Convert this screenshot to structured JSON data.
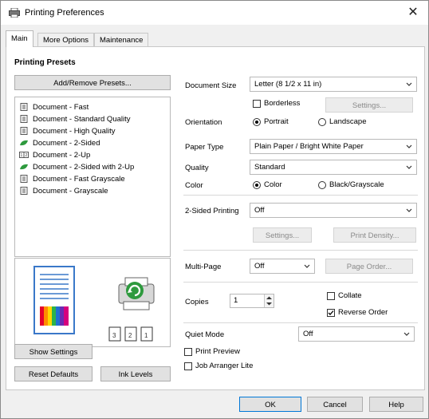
{
  "window": {
    "title": "Printing Preferences",
    "close_label": "✕"
  },
  "tabs": [
    {
      "label": "Main",
      "active": true
    },
    {
      "label": "More Options",
      "active": false
    },
    {
      "label": "Maintenance",
      "active": false
    }
  ],
  "presets": {
    "heading": "Printing Presets",
    "add_remove_label": "Add/Remove Presets...",
    "items": [
      {
        "label": "Document - Fast",
        "icon": "document-icon"
      },
      {
        "label": "Document - Standard Quality",
        "icon": "document-icon"
      },
      {
        "label": "Document - High Quality",
        "icon": "document-icon"
      },
      {
        "label": "Document - 2-Sided",
        "icon": "eco-icon"
      },
      {
        "label": "Document - 2-Up",
        "icon": "two-up-icon"
      },
      {
        "label": "Document - 2-Sided with 2-Up",
        "icon": "eco-icon"
      },
      {
        "label": "Document - Fast Grayscale",
        "icon": "document-icon"
      },
      {
        "label": "Document - Grayscale",
        "icon": "document-icon"
      }
    ]
  },
  "settings": {
    "document_size": {
      "label": "Document Size",
      "value": "Letter (8 1/2 x 11 in)"
    },
    "borderless": {
      "label": "Borderless",
      "checked": false
    },
    "settings_button": "Settings...",
    "orientation": {
      "label": "Orientation",
      "portrait": "Portrait",
      "landscape": "Landscape",
      "selected": "Portrait"
    },
    "paper_type": {
      "label": "Paper Type",
      "value": "Plain Paper / Bright White Paper"
    },
    "quality": {
      "label": "Quality",
      "value": "Standard"
    },
    "color": {
      "label": "Color",
      "color": "Color",
      "grayscale": "Black/Grayscale",
      "selected": "Color"
    },
    "two_sided": {
      "label": "2-Sided Printing",
      "value": "Off",
      "settings_label": "Settings...",
      "density_label": "Print Density..."
    },
    "multi_page": {
      "label": "Multi-Page",
      "value": "Off",
      "page_order_label": "Page Order..."
    },
    "copies": {
      "label": "Copies",
      "value": "1"
    },
    "collate": {
      "label": "Collate",
      "checked": false
    },
    "reverse_order": {
      "label": "Reverse Order",
      "checked": true
    },
    "quiet_mode": {
      "label": "Quiet Mode",
      "value": "Off"
    },
    "print_preview": {
      "label": "Print Preview",
      "checked": false
    },
    "job_arranger": {
      "label": "Job Arranger Lite",
      "checked": false
    }
  },
  "left_buttons": {
    "show_settings": "Show Settings",
    "reset_defaults": "Reset Defaults",
    "ink_levels": "Ink Levels"
  },
  "dialog_buttons": {
    "ok": "OK",
    "cancel": "Cancel",
    "help": "Help"
  },
  "colors": {
    "accent_green": "#2e9a3e",
    "button_bg": "#e1e1e1"
  }
}
